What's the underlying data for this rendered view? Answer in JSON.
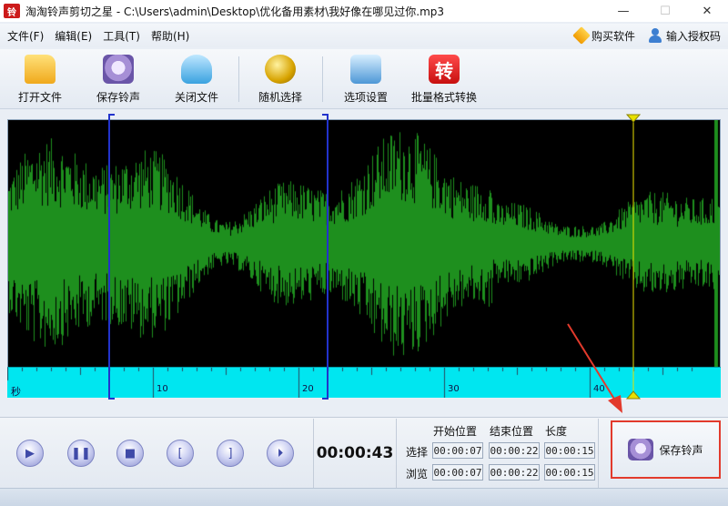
{
  "window": {
    "title": "淘淘铃声剪切之星 - C:\\Users\\admin\\Desktop\\优化备用素材\\我好像在哪见过你.mp3",
    "app_icon_text": "铃",
    "minimize": "—",
    "maximize": "☐",
    "close": "✕"
  },
  "menu": {
    "items": [
      "文件(F)",
      "编辑(E)",
      "工具(T)",
      "帮助(H)"
    ],
    "buy": "购买软件",
    "license": "输入授权码"
  },
  "toolbar": {
    "open": "打开文件",
    "save": "保存铃声",
    "close": "关闭文件",
    "random": "随机选择",
    "options": "选项设置",
    "batch": "批量格式转换",
    "batch_icon_text": "转"
  },
  "timeline": {
    "unit": "秒",
    "ticks": [
      "10",
      "20",
      "30",
      "40"
    ],
    "tick_values": [
      10,
      20,
      30,
      40
    ],
    "selection_start_s": 7,
    "selection_end_s": 22,
    "cursor_s": 43,
    "max_s": 47.5
  },
  "player": {
    "current_time": "00:00:43",
    "buttons": [
      "play",
      "pause",
      "stop",
      "set-start",
      "set-end",
      "play-selection"
    ]
  },
  "positions": {
    "headers": [
      "开始位置",
      "结束位置",
      "长度"
    ],
    "rows": [
      {
        "label": "选择",
        "start": "00:00:07",
        "end": "00:00:22",
        "length": "00:00:15"
      },
      {
        "label": "浏览",
        "start": "00:00:07",
        "end": "00:00:22",
        "length": "00:00:15"
      }
    ]
  },
  "save_ringtone": "保存铃声",
  "colors": {
    "waveform": "#1e8f1e",
    "waveform_bg": "#000000",
    "ruler": "#00e6f0",
    "selection": "#2233cc",
    "cursor": "#e8e000",
    "highlight": "#e23a2c"
  }
}
